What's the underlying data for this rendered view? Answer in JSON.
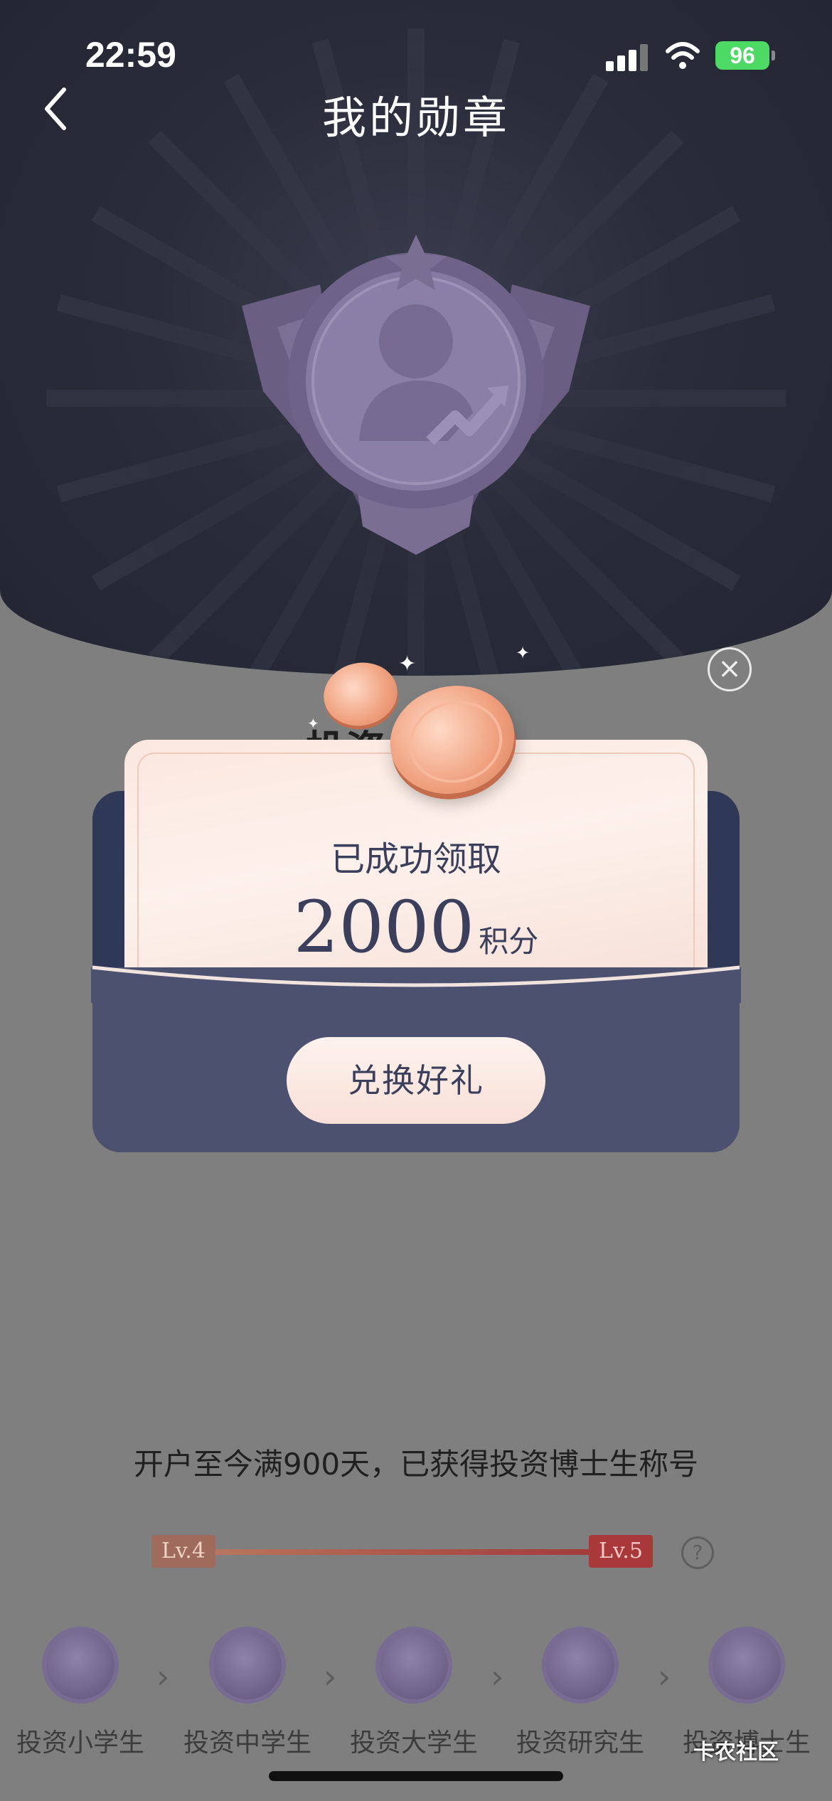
{
  "status_bar": {
    "time": "22:59",
    "battery": "96"
  },
  "header": {
    "title": "我的勋章"
  },
  "badge": {
    "name": "medal-investment-doctor"
  },
  "modal": {
    "title": "已成功领取",
    "amount": "2000",
    "unit": "积分",
    "button": "兑换好礼"
  },
  "progress": {
    "description": "开户至今满900天，已获得投资博士生称号",
    "left_level": "Lv.4",
    "right_level": "Lv.5",
    "help": "?"
  },
  "levels": [
    {
      "label": "投资小学生"
    },
    {
      "label": "投资中学生"
    },
    {
      "label": "投资大学生"
    },
    {
      "label": "投资研究生"
    },
    {
      "label": "投资博士生"
    }
  ],
  "watermark": "卡农社区",
  "colors": {
    "header_bg": "#2a2c3a",
    "envelope": "#4d5170",
    "card": "#fbe7df",
    "text_dark": "#3b3f5c",
    "battery": "#4cd964"
  }
}
